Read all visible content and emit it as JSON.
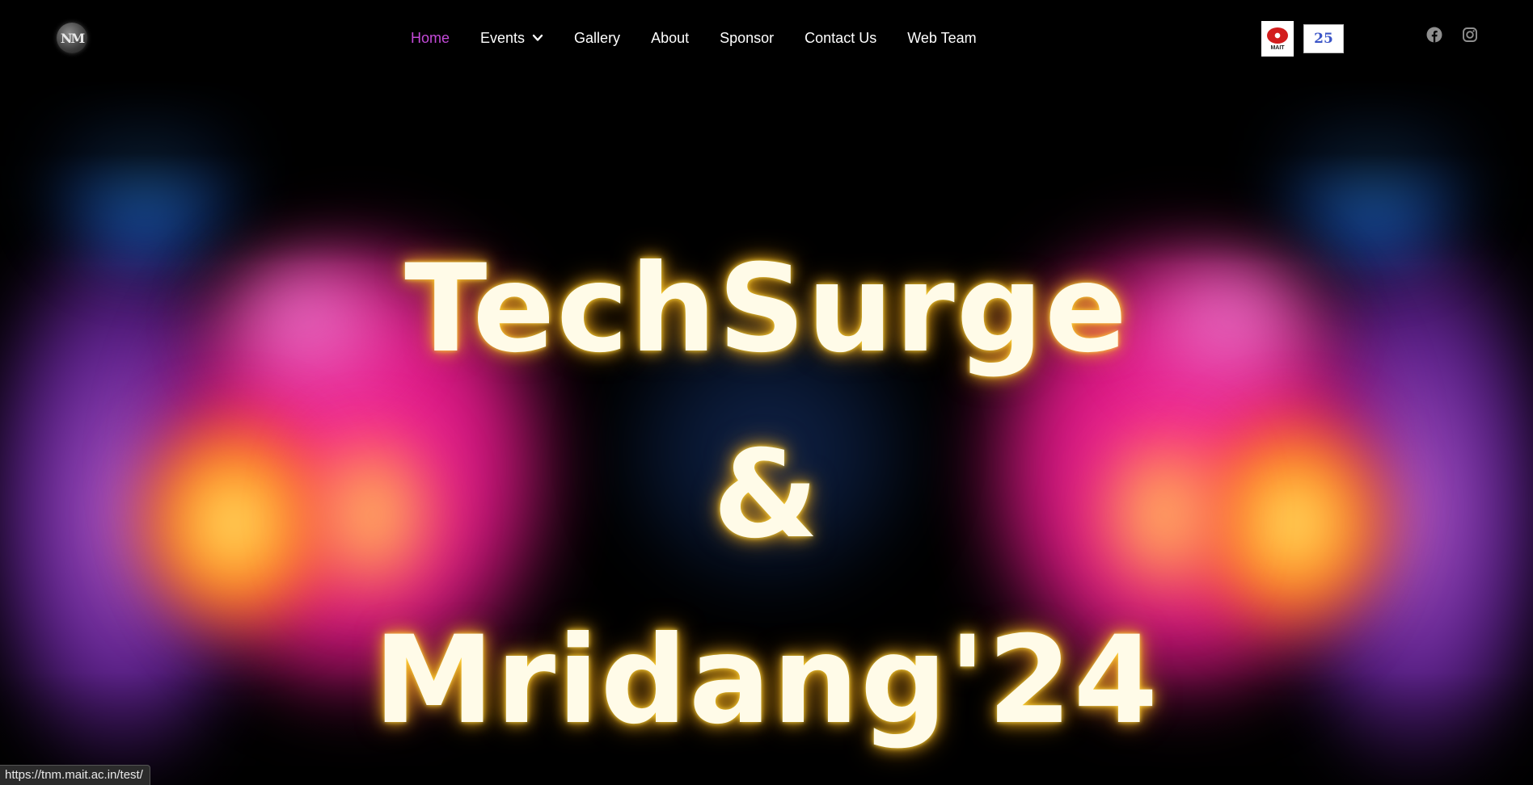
{
  "navbar": {
    "logo_text": "NM",
    "menu": [
      {
        "label": "Home",
        "active": true
      },
      {
        "label": "Events",
        "has_dropdown": true
      },
      {
        "label": "Gallery"
      },
      {
        "label": "About"
      },
      {
        "label": "Sponsor"
      },
      {
        "label": "Contact Us"
      },
      {
        "label": "Web Team"
      }
    ],
    "partner_logos": [
      {
        "name": "mait-logo",
        "text": "MAIT"
      },
      {
        "name": "25-years-logo",
        "text": "25"
      }
    ],
    "social_icons": [
      "facebook-icon",
      "instagram-icon"
    ],
    "active_color": "#c44ad9"
  },
  "hero": {
    "title_line_1": "TechSurge",
    "title_line_2": "&",
    "title_line_3": "Mridang'24",
    "title_color": "#fffbe8",
    "glow_color": "#ffc21e"
  },
  "status_bar": {
    "url": "https://tnm.mait.ac.in/test/"
  }
}
